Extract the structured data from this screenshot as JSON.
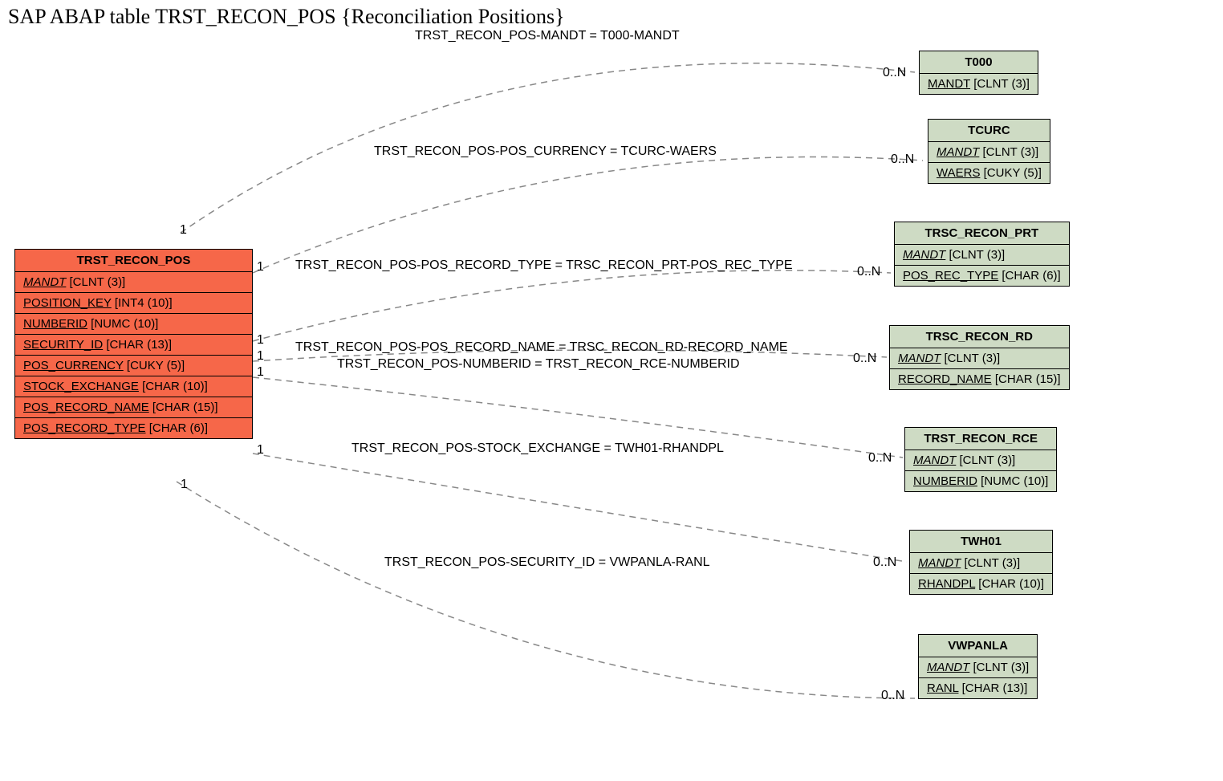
{
  "title": "SAP ABAP table TRST_RECON_POS {Reconciliation Positions}",
  "main_entity": {
    "name": "TRST_RECON_POS",
    "fields": [
      {
        "name": "MANDT",
        "type": "[CLNT (3)]",
        "italic": true
      },
      {
        "name": "POSITION_KEY",
        "type": "[INT4 (10)]",
        "italic": false
      },
      {
        "name": "NUMBERID",
        "type": "[NUMC (10)]",
        "italic": false
      },
      {
        "name": "SECURITY_ID",
        "type": "[CHAR (13)]",
        "italic": false
      },
      {
        "name": "POS_CURRENCY",
        "type": "[CUKY (5)]",
        "italic": false
      },
      {
        "name": "STOCK_EXCHANGE",
        "type": "[CHAR (10)]",
        "italic": false
      },
      {
        "name": "POS_RECORD_NAME",
        "type": "[CHAR (15)]",
        "italic": false
      },
      {
        "name": "POS_RECORD_TYPE",
        "type": "[CHAR (6)]",
        "italic": false
      }
    ]
  },
  "targets": [
    {
      "name": "T000",
      "fields": [
        {
          "name": "MANDT",
          "type": "[CLNT (3)]",
          "italic": false
        }
      ]
    },
    {
      "name": "TCURC",
      "fields": [
        {
          "name": "MANDT",
          "type": "[CLNT (3)]",
          "italic": true
        },
        {
          "name": "WAERS",
          "type": "[CUKY (5)]",
          "italic": false
        }
      ]
    },
    {
      "name": "TRSC_RECON_PRT",
      "fields": [
        {
          "name": "MANDT",
          "type": "[CLNT (3)]",
          "italic": true
        },
        {
          "name": "POS_REC_TYPE",
          "type": "[CHAR (6)]",
          "italic": false
        }
      ]
    },
    {
      "name": "TRSC_RECON_RD",
      "fields": [
        {
          "name": "MANDT",
          "type": "[CLNT (3)]",
          "italic": true
        },
        {
          "name": "RECORD_NAME",
          "type": "[CHAR (15)]",
          "italic": false
        }
      ]
    },
    {
      "name": "TRST_RECON_RCE",
      "fields": [
        {
          "name": "MANDT",
          "type": "[CLNT (3)]",
          "italic": true
        },
        {
          "name": "NUMBERID",
          "type": "[NUMC (10)]",
          "italic": false
        }
      ]
    },
    {
      "name": "TWH01",
      "fields": [
        {
          "name": "MANDT",
          "type": "[CLNT (3)]",
          "italic": true
        },
        {
          "name": "RHANDPL",
          "type": "[CHAR (10)]",
          "italic": false
        }
      ]
    },
    {
      "name": "VWPANLA",
      "fields": [
        {
          "name": "MANDT",
          "type": "[CLNT (3)]",
          "italic": true
        },
        {
          "name": "RANL",
          "type": "[CHAR (13)]",
          "italic": false
        }
      ]
    }
  ],
  "relations": [
    {
      "text": "TRST_RECON_POS-MANDT = T000-MANDT"
    },
    {
      "text": "TRST_RECON_POS-POS_CURRENCY = TCURC-WAERS"
    },
    {
      "text": "TRST_RECON_POS-POS_RECORD_TYPE = TRSC_RECON_PRT-POS_REC_TYPE"
    },
    {
      "text": "TRST_RECON_POS-POS_RECORD_NAME = TRSC_RECON_RD-RECORD_NAME"
    },
    {
      "text": "TRST_RECON_POS-NUMBERID = TRST_RECON_RCE-NUMBERID"
    },
    {
      "text": "TRST_RECON_POS-STOCK_EXCHANGE = TWH01-RHANDPL"
    },
    {
      "text": "TRST_RECON_POS-SECURITY_ID = VWPANLA-RANL"
    }
  ],
  "cards": {
    "left": [
      "1",
      "1",
      "1",
      "1",
      "1",
      "1",
      "1"
    ],
    "right": [
      "0..N",
      "0..N",
      "0..N",
      "0..N",
      "0..N",
      "0..N",
      "0..N"
    ]
  }
}
